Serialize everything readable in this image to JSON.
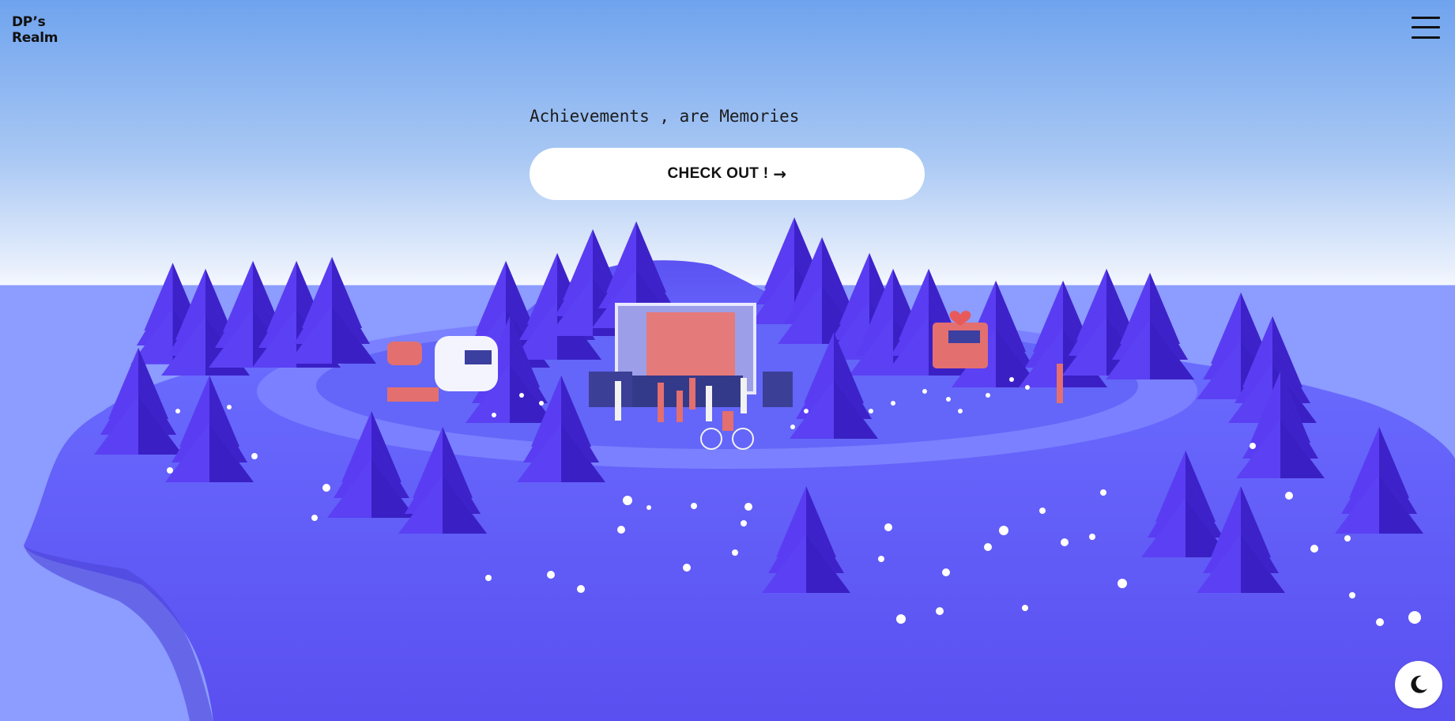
{
  "brand": {
    "line1": "DP’s",
    "line2": "Realm"
  },
  "hero": {
    "tagline": "Achievements , are Memories",
    "cta_label": "CHECK OUT !",
    "cta_arrow": "→"
  },
  "icons": {
    "menu": "hamburger-menu-icon",
    "theme": "moon-icon"
  },
  "colors": {
    "sky_top": "#6fa3ee",
    "horizon": "#f4f7ff",
    "ground": "#6b63ff",
    "trees": "#4a2ee6",
    "screen": "#e57a7a",
    "accent_white": "#ffffff"
  }
}
